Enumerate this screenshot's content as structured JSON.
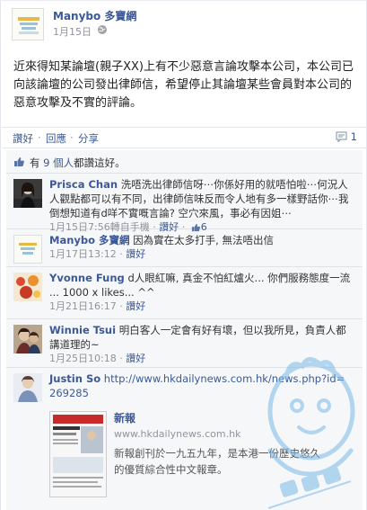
{
  "post": {
    "author": "Manybo 多寶網",
    "time": "1月15日",
    "text": "近來得知某論壇(親子XX)上有不少惡意言論攻擊本公司，本公司已向該論壇的公司發出律師信，希望停止其論壇某些會員對本公司的惡意攻擊及不實的評論。"
  },
  "actions": {
    "like": "讚好",
    "dot1": "·",
    "reply": "回應",
    "dot2": "·",
    "share": "分享",
    "comment_count": "1"
  },
  "likes": {
    "prefix": "有",
    "count_link": "9 個人",
    "suffix": "都讚這好。"
  },
  "comments": [
    {
      "name": "Prisca Chan",
      "text": " 洗唔洗出律師信呀⋯你係好用的就唔怕啦⋯何況人人觀點都可以有不同，出律師信味反而令人地有多一樣野話你⋯我倒想知道有d咩不實嘅言論? 空穴來風，事必有因姐⋯",
      "meta": "1月15日7:56轉自手機",
      "dot": " · ",
      "like": "讚好",
      "dot2": " · ",
      "likes": "6"
    },
    {
      "name": "Manybo 多寶網",
      "text": " 因為實在太多打手, 無法唔出信",
      "meta": "1月17日13:12",
      "dot": " · ",
      "like": "讚好"
    },
    {
      "name": "Yvonne Fung",
      "text": " d人眼紅嘛, 真金不怕紅爐火... 你們服務態度一流 ... 1000 x likes... ^^",
      "meta": "1月21日16:17",
      "dot": " · ",
      "like": "讚好"
    },
    {
      "name": "Winnie Tsui",
      "text": " 明白客人一定會有好有壞，但以我所見，負責人都講道理的~",
      "meta": "1月25日10:18",
      "dot": " · ",
      "like": "讚好"
    },
    {
      "name": "Justin So",
      "text": " http://www.hkdailynews.com.hk/news.php?id=269285",
      "card": {
        "title": "新報",
        "domain": "www.hkdailynews.com.hk",
        "desc": "新報創刊於一九五九年，是本港一份歷史悠久的優質綜合性中文報章。"
      }
    }
  ],
  "colors": {
    "link": "#3b5998",
    "meta": "#90949c",
    "ufi_bg": "#f6f7f9"
  },
  "icons": [
    "privacy-globe-icon",
    "comment-icon",
    "thumbs-up-icon",
    "like-badge-icon"
  ]
}
